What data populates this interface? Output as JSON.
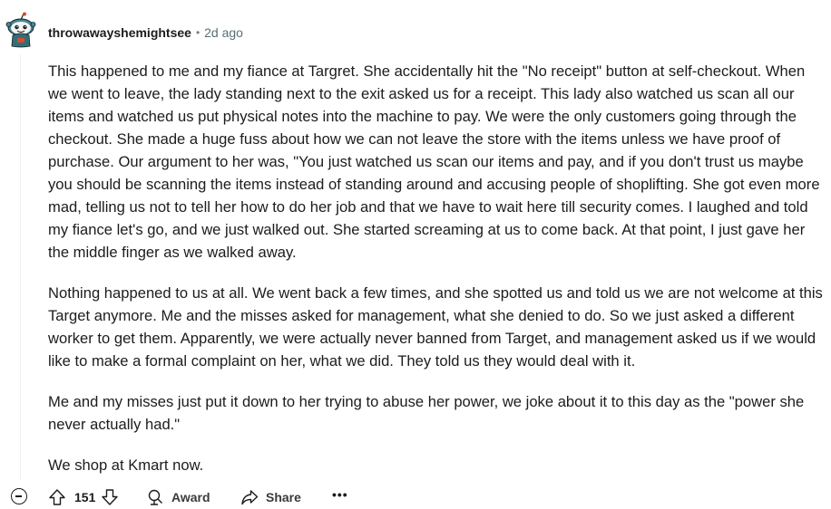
{
  "comment": {
    "author": "throwawayshemightsee",
    "separator": "•",
    "age": "2d ago",
    "paragraphs": [
      "This happened to me and my fiance at Targret. She accidentally hit the \"No receipt\" button at self-checkout. When we went to leave, the lady standing next to the exit asked us for a receipt. This lady also watched us scan all our items and watched us put physical notes into the machine to pay. We were the only customers going through the checkout. She made a huge fuss about how we can not leave the store with the items unless we have proof of purchase. Our argument to her was, \"You just watched us scan our items and pay, and if you don't trust us maybe you should be scanning the items instead of standing around and accusing people of shoplifting. She got even more mad, telling us not to tell her how to do her job and that we have to wait here till security comes. I laughed and told my fiance let's go, and we just walked out. She started screaming at us to come back. At that point, I just gave her the middle finger as we walked away.",
      "Nothing happened to us at all. We went back a few times, and she spotted us and told us we are not welcome at this Target anymore. Me and the misses asked for management, what she denied to do. So we just asked a different worker to get them. Apparently, we were actually never banned from Target, and management asked us if we would like to make a formal complaint on her, what we did. They told us they would deal with it.",
      "Me and my misses just put it down to her trying to abuse her power, we joke about it to this day as the \"power she never actually had.\"",
      "We shop at Kmart now."
    ]
  },
  "actions": {
    "score": "151",
    "award_label": "Award",
    "share_label": "Share",
    "more_label": "•••"
  },
  "icons": {
    "collapse": "collapse-minus-icon",
    "upvote": "upvote-arrow-icon",
    "downvote": "downvote-arrow-icon",
    "award": "award-icon",
    "share": "share-icon",
    "more": "more-dots-icon"
  },
  "colors": {
    "text": "#1c1c1c",
    "muted": "#576f76",
    "avatar_bg": "#3f8a9a",
    "avatar_accent": "#d94b2b"
  }
}
